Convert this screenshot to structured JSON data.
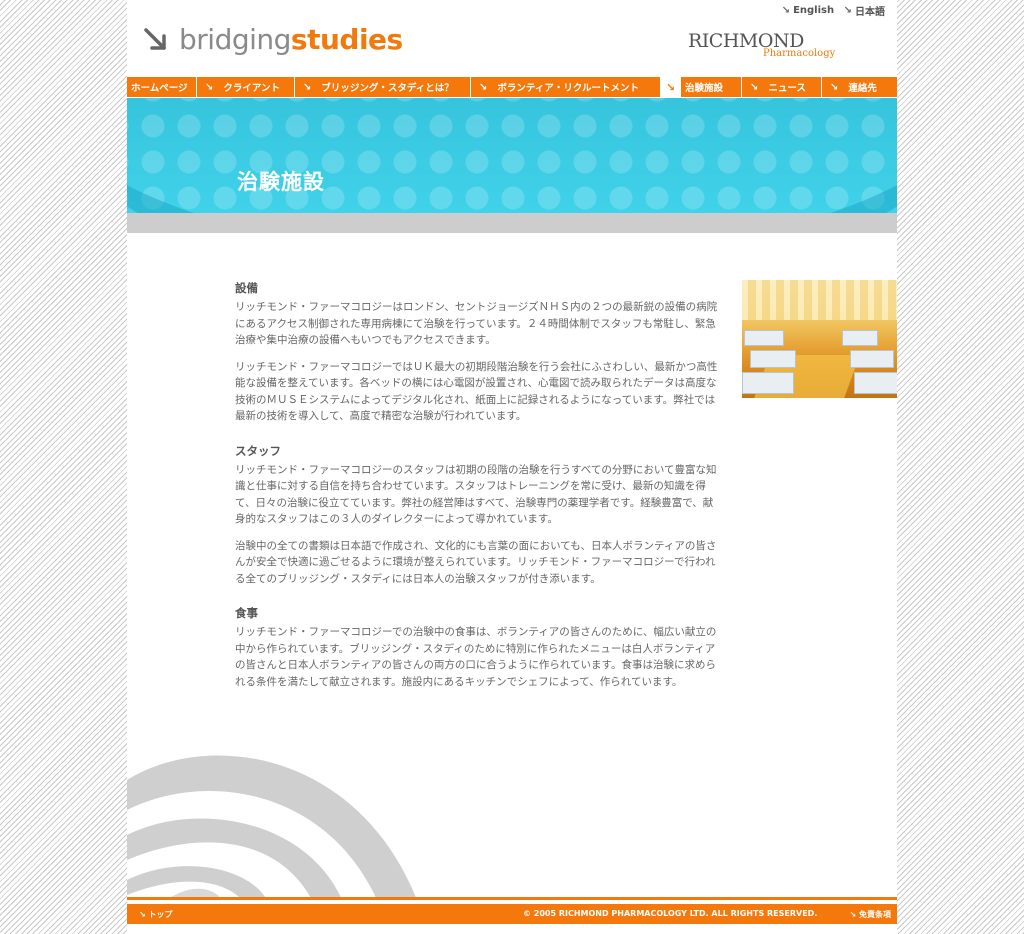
{
  "header": {
    "lang_english": "English",
    "lang_japanese": "日本語",
    "logo_part1": "bridging",
    "logo_part2": "studies",
    "richmond_name": "RICHMOND",
    "richmond_sub": "Pharmacology"
  },
  "nav": {
    "items": [
      {
        "label": "ホームページ"
      },
      {
        "label": "クライアント"
      },
      {
        "label": "ブリッジング・スタディとは？"
      },
      {
        "label": "ボランティア・リクルートメント"
      },
      {
        "label": "治験施設"
      },
      {
        "label": "ニュース"
      },
      {
        "label": "連絡先"
      }
    ]
  },
  "banner": {
    "title": "治験施設"
  },
  "sections": [
    {
      "heading": "設備",
      "paragraphs": [
        "リッチモンド・ファーマコロジーはロンドン、セントジョージズＮＨＳ内の２つの最新鋭の設備の病院にあるアクセス制御された専用病棟にて治験を行っています。２４時間体制でスタッフも常駐し、緊急治療や集中治療の設備へもいつでもアクセスできます。",
        "リッチモンド・ファーマコロジーではＵＫ最大の初期段階治験を行う会社にふさわしい、最新かつ高性能な設備を整えています。各ベッドの横には心電図が設置され、心電図で読み取られたデータは高度な技術のＭＵＳＥシステムによってデジタル化され、紙面上に記録されるようになっています。弊社では最新の技術を導入して、高度で精密な治験が行われています。"
      ]
    },
    {
      "heading": "スタッフ",
      "paragraphs": [
        "リッチモンド・ファーマコロジーのスタッフは初期の段階の治験を行うすべての分野において豊富な知識と仕事に対する自信を持ち合わせています。スタッフはトレーニングを常に受け、最新の知識を得て、日々の治験に役立てています。弊社の経営陣はすべて、治験専門の薬理学者です。経験豊富で、献身的なスタッフはこの３人のダイレクターによって導かれています。",
        "治験中の全ての書類は日本語で作成され、文化的にも言葉の面においても、日本人ボランティアの皆さんが安全で快適に過ごせるように環境が整えられています。リッチモンド・ファーマコロジーで行われる全てのブリッジング・スタディには日本人の治験スタッフが付き添います。"
      ]
    },
    {
      "heading": "食事",
      "paragraphs": [
        "リッチモンド・ファーマコロジーでの治験中の食事は、ボランティアの皆さんのために、幅広い献立の中から作られています。ブリッジング・スタディのために特別に作られたメニューは白人ボランティアの皆さんと日本人ボランティアの皆さんの両方の口に合うように作られています。食事は治験に求められる条件を満たして献立されます。施設内にあるキッチンでシェフによって、作られています。"
      ]
    }
  ],
  "footer": {
    "top_link": "トップ",
    "copyright": "© 2005 RICHMOND PHARMACOLOGY LTD. ALL RIGHTS RESERVED.",
    "disclaimer": "免責条項"
  },
  "colors": {
    "accent": "#f5780d",
    "banner": "#40d2ea",
    "text": "#666666"
  }
}
